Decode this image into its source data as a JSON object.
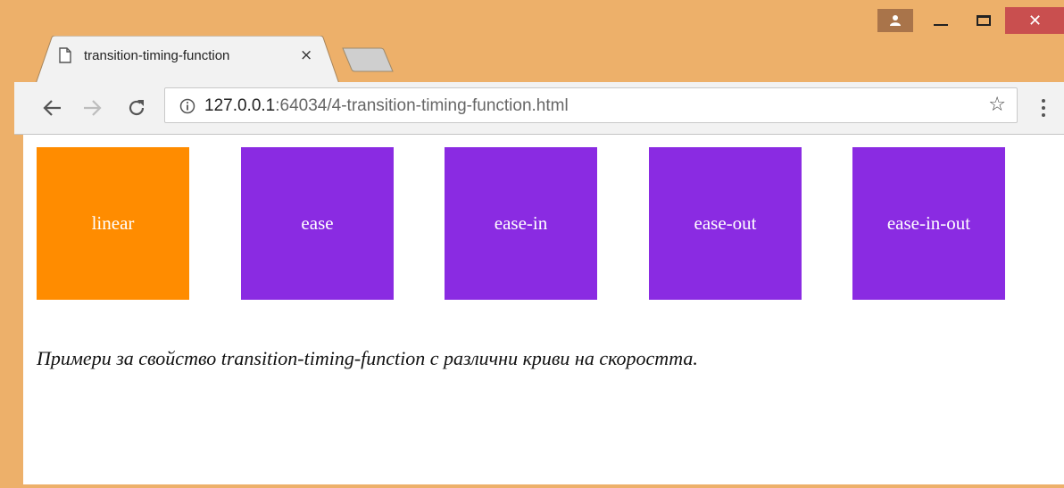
{
  "window": {
    "user_icon": "person-icon",
    "minimize_icon": "minimize-icon",
    "maximize_icon": "maximize-icon",
    "close_label": "✕"
  },
  "tab": {
    "title": "transition-timing-function",
    "close_label": "×",
    "icon": "document-icon"
  },
  "toolbar": {
    "url_host": "127.0.0.1",
    "url_rest": ":64034/4-transition-timing-function.html",
    "bookmark_label": "☆"
  },
  "boxes": [
    {
      "label": "linear",
      "color": "#ff8c00"
    },
    {
      "label": "ease",
      "color": "#8a2be2"
    },
    {
      "label": "ease-in",
      "color": "#8a2be2"
    },
    {
      "label": "ease-out",
      "color": "#8a2be2"
    },
    {
      "label": "ease-in-out",
      "color": "#8a2be2"
    }
  ],
  "caption": "Примери за свойство transition-timing-function с различни криви на скоростта.",
  "colors": {
    "frame": "#edb06a",
    "accent_orange": "#ff8c00",
    "accent_purple": "#8a2be2",
    "close_red": "#c94f4f"
  }
}
